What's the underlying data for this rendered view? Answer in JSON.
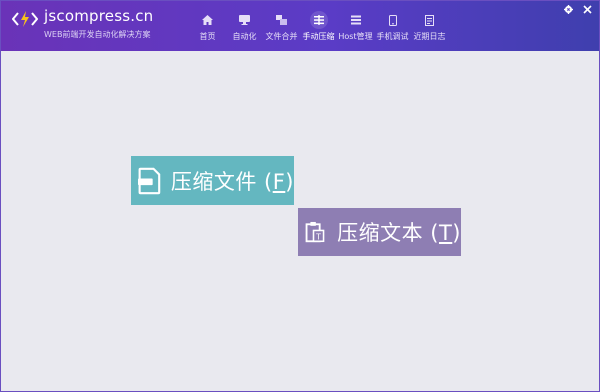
{
  "brand": {
    "name": "jscompress.cn",
    "subtitle": "WEB前端开发自动化解决方案"
  },
  "nav": {
    "items": [
      {
        "label": "首页",
        "icon": "home-icon"
      },
      {
        "label": "自动化",
        "icon": "monitor-icon"
      },
      {
        "label": "文件合并",
        "icon": "merge-icon"
      },
      {
        "label": "手动压缩",
        "icon": "compress-icon",
        "active": true
      },
      {
        "label": "Host管理",
        "icon": "list-icon"
      },
      {
        "label": "手机调试",
        "icon": "phone-icon"
      },
      {
        "label": "近期日志",
        "icon": "log-icon"
      }
    ]
  },
  "window_controls": [
    "gear-icon",
    "close-icon"
  ],
  "actions": {
    "compress_file": {
      "text": "压缩文件 (",
      "hotkey": "F",
      "suffix": ")",
      "icon": "file-icon"
    },
    "compress_text": {
      "text": "压缩文本 (",
      "hotkey": "T",
      "suffix": ")",
      "icon": "clipboard-text-icon"
    }
  },
  "colors": {
    "header_start": "#6a33b8",
    "header_end": "#3f3fae",
    "file_button": "#64b7c0",
    "text_button": "#8e7eb3",
    "background": "#e9e9ef"
  }
}
